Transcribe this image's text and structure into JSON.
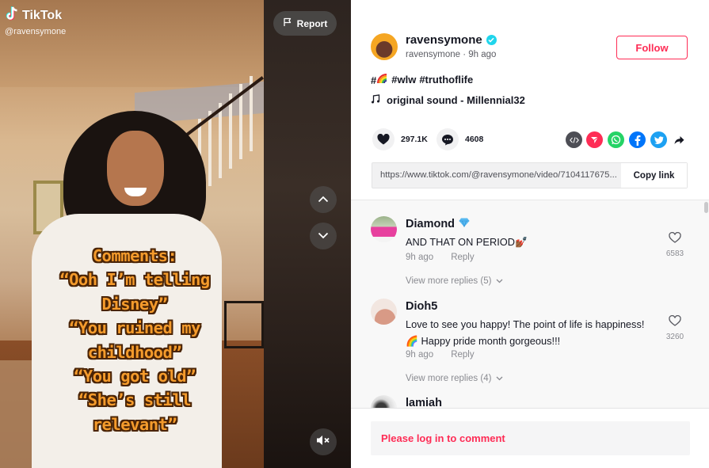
{
  "video": {
    "brand_label": "TikTok",
    "watermark_handle": "@ravensymone",
    "report_label": "Report",
    "caption_lines": [
      "Comments:",
      "“Ooh I’m telling",
      "Disney”",
      "“You ruined my",
      "childhood”",
      "“You got old”",
      "“She’s still",
      "relevant”"
    ],
    "nav_up_icon": "chevron-up-icon",
    "nav_down_icon": "chevron-down-icon",
    "mute_icon": "volume-muted-icon"
  },
  "author": {
    "display_name": "ravensymone",
    "verified": true,
    "username": "ravensymone",
    "posted_ago": "9h ago",
    "meta_separator": " · ",
    "follow_label": "Follow"
  },
  "description": {
    "hashtags": [
      "#",
      "#wlw",
      "#truthoflife"
    ],
    "rainbow_emoji": "🌈"
  },
  "sound": {
    "label": "original sound - Millennial32"
  },
  "stats": {
    "likes": "297.1K",
    "comments": "4608"
  },
  "share": {
    "icons": [
      "embed-icon",
      "tiktok-send-icon",
      "whatsapp-icon",
      "facebook-icon",
      "twitter-icon",
      "share-arrow-icon"
    ],
    "colors": {
      "embed": "#4d4e55",
      "send": "#fe2c55",
      "whatsapp": "#25d366",
      "facebook": "#0075fa",
      "twitter": "#1da1f2"
    }
  },
  "link": {
    "url": "https://www.tiktok.com/@ravensymone/video/7104117675...",
    "copy_label": "Copy link"
  },
  "comments": [
    {
      "author": "Diamond",
      "badge_emoji": "💎",
      "text": "AND THAT ON PERIOD💅🏾",
      "time": "9h ago",
      "reply_label": "Reply",
      "likes": "6583",
      "more_replies": "View more replies (5)"
    },
    {
      "author": "Dioh5",
      "text_line1": "Love to see you happy! The point of life is happiness!",
      "text_line2": "🌈 Happy pride month gorgeous!!!",
      "time": "9h ago",
      "reply_label": "Reply",
      "likes": "3260",
      "more_replies": "View more replies (4)"
    },
    {
      "author": "lamiah"
    }
  ],
  "footer": {
    "login_prompt": "Please log in to comment"
  },
  "colors": {
    "brand_red": "#fe2c55",
    "verified_blue": "#20d5ec",
    "caption_orange": "#f49b2c"
  }
}
